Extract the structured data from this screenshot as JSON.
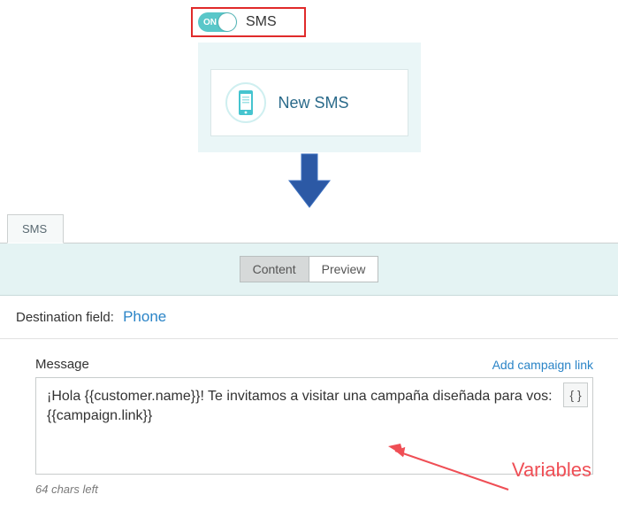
{
  "toggle": {
    "state_text": "ON",
    "label": "SMS"
  },
  "card": {
    "title": "New SMS"
  },
  "tabs": {
    "sms": "SMS"
  },
  "segmented": {
    "content": "Content",
    "preview": "Preview"
  },
  "destination": {
    "label": "Destination field:",
    "value": "Phone"
  },
  "message": {
    "label": "Message",
    "add_link": "Add campaign link",
    "text": "¡Hola {{customer.name}}! Te invitamos a visitar una campaña diseñada para vos: {{campaign.link}}",
    "variables_button": "{ }",
    "chars_left": "64 chars left"
  },
  "annotation": {
    "text": "Variables"
  }
}
